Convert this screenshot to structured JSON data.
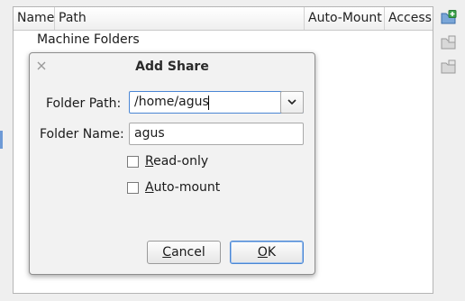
{
  "table": {
    "columns": [
      "Name",
      "Path",
      "Auto-Mount",
      "Access"
    ],
    "group_label": "Machine Folders"
  },
  "toolbar": {
    "add_icon": "add-share-icon",
    "edit_icon": "edit-share-icon",
    "remove_icon": "remove-share-icon"
  },
  "dialog": {
    "title": "Add Share",
    "folder_path_label": "Folder Path:",
    "folder_path_value": "/home/agus",
    "folder_name_label": "Folder Name:",
    "folder_name_value": "agus",
    "readonly_label_mnemonic": "R",
    "readonly_label_rest": "ead-only",
    "readonly_checked": false,
    "automount_label_mnemonic": "A",
    "automount_label_rest": "uto-mount",
    "automount_checked": false,
    "cancel_mnemonic": "C",
    "cancel_rest": "ancel",
    "ok_mnemonic": "O",
    "ok_rest": "K"
  },
  "colors": {
    "focus_blue": "#4a86d4",
    "accent_green": "#3aa24a"
  }
}
